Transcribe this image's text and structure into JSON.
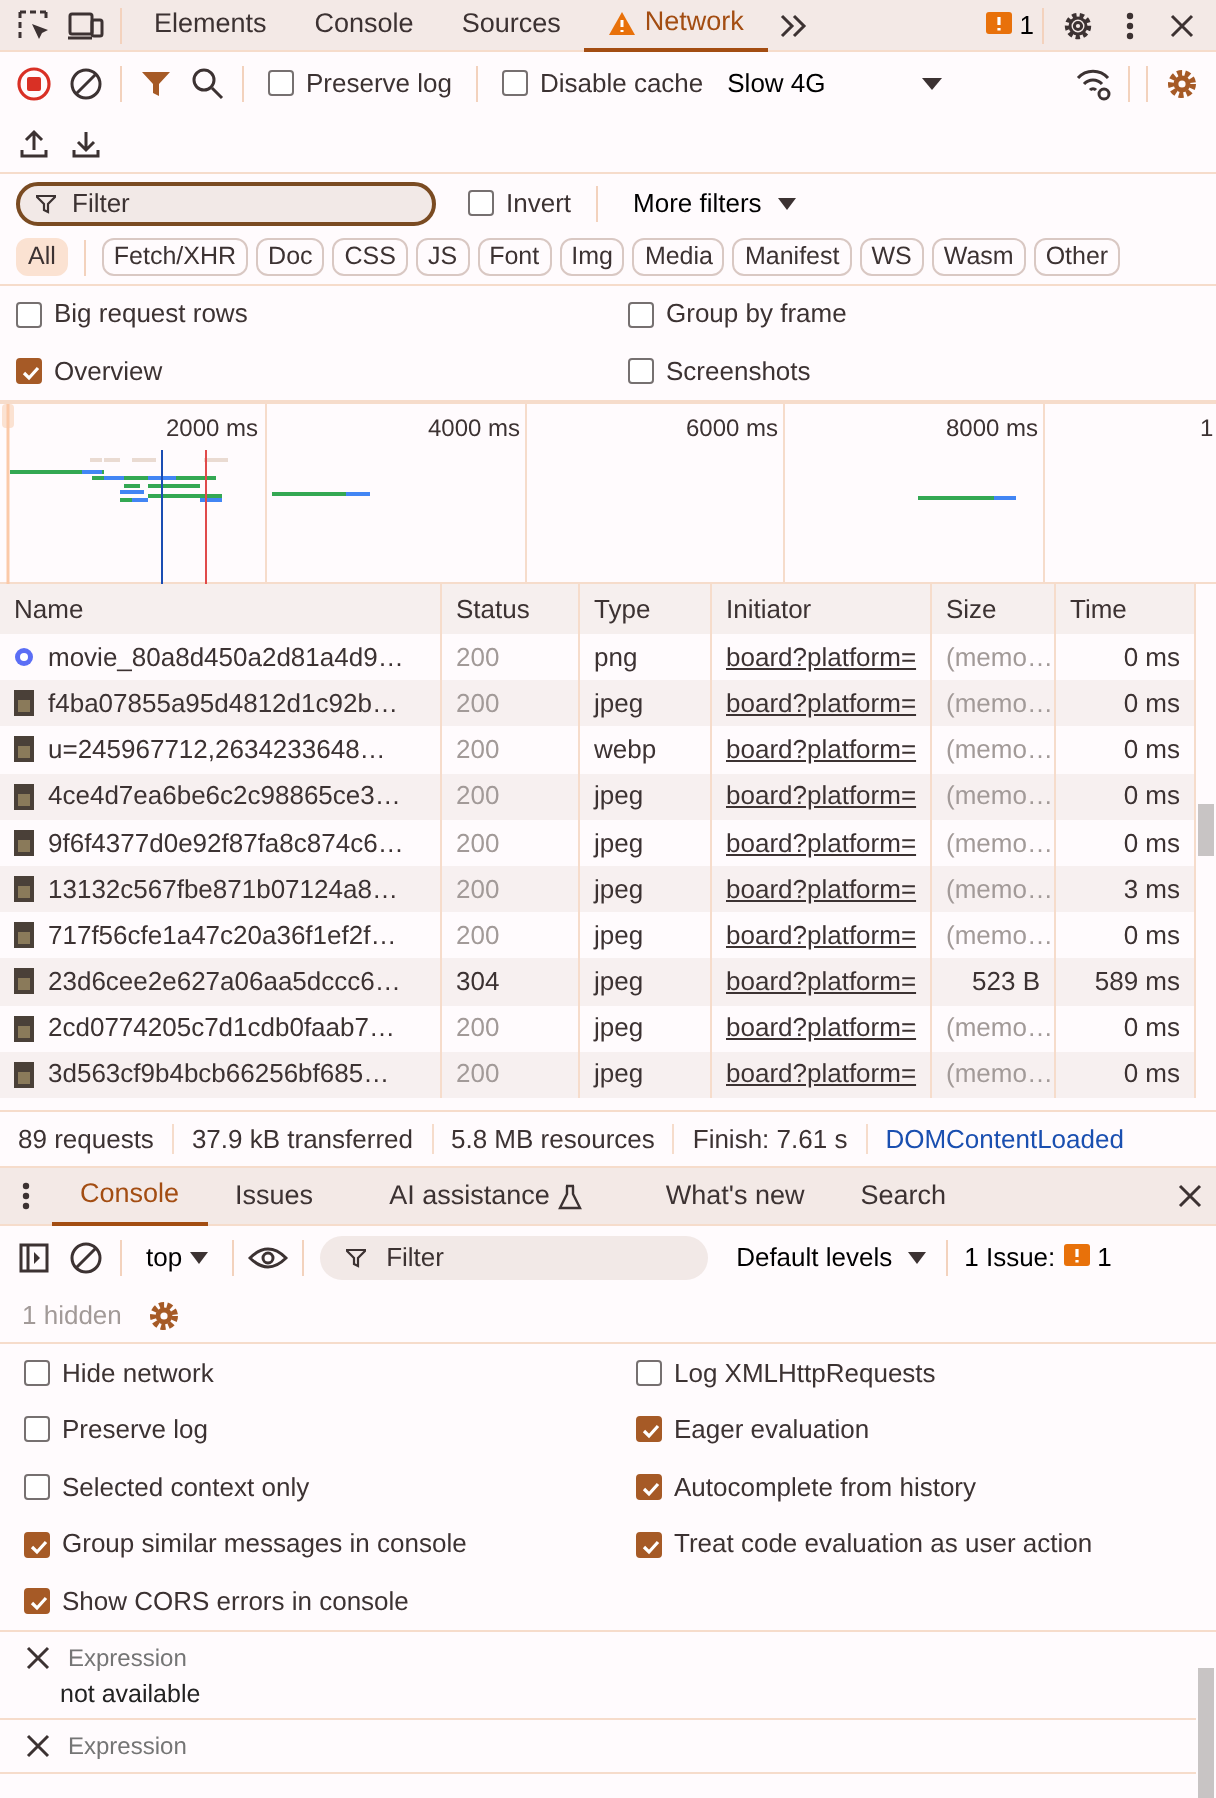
{
  "main_tabs": [
    {
      "label": "Elements",
      "selected": false,
      "warning": false
    },
    {
      "label": "Console",
      "selected": false,
      "warning": false
    },
    {
      "label": "Sources",
      "selected": false,
      "warning": false
    },
    {
      "label": "Network",
      "selected": true,
      "warning": true
    }
  ],
  "issues_badge": "1",
  "toolbar": {
    "recording": true,
    "preserve_log": {
      "label": "Preserve log",
      "checked": false
    },
    "disable_cache": {
      "label": "Disable cache",
      "checked": false
    },
    "throttling": "Slow 4G"
  },
  "filter": {
    "placeholder": "Filter",
    "invert": {
      "label": "Invert",
      "checked": false
    },
    "more_filters": "More filters"
  },
  "type_filters": [
    {
      "label": "All",
      "selected": true
    },
    {
      "label": "Fetch/XHR",
      "selected": false
    },
    {
      "label": "Doc",
      "selected": false
    },
    {
      "label": "CSS",
      "selected": false
    },
    {
      "label": "JS",
      "selected": false
    },
    {
      "label": "Font",
      "selected": false
    },
    {
      "label": "Img",
      "selected": false
    },
    {
      "label": "Media",
      "selected": false
    },
    {
      "label": "Manifest",
      "selected": false
    },
    {
      "label": "WS",
      "selected": false
    },
    {
      "label": "Wasm",
      "selected": false
    },
    {
      "label": "Other",
      "selected": false
    }
  ],
  "options": [
    {
      "label": "Big request rows",
      "checked": false
    },
    {
      "label": "Group by frame",
      "checked": false
    },
    {
      "label": "Overview",
      "checked": true
    },
    {
      "label": "Screenshots",
      "checked": false
    }
  ],
  "overview": {
    "ticks": [
      "2000 ms",
      "4000 ms",
      "6000 ms",
      "8000 ms",
      "1"
    ]
  },
  "table": {
    "columns": [
      "Name",
      "Status",
      "Type",
      "Initiator",
      "Size",
      "Time"
    ],
    "rows": [
      {
        "name": "movie_80a8d450a2d81a4d9…",
        "status": "200",
        "type": "png",
        "initiator": "board?platform=",
        "size": "(memo…",
        "time": "0 ms",
        "cached": true,
        "kind": "logo"
      },
      {
        "name": "f4ba07855a95d4812d1c92b…",
        "status": "200",
        "type": "jpeg",
        "initiator": "board?platform=",
        "size": "(memo…",
        "time": "0 ms",
        "cached": true,
        "kind": "photo"
      },
      {
        "name": "u=245967712,2634233648…",
        "status": "200",
        "type": "webp",
        "initiator": "board?platform=",
        "size": "(memo…",
        "time": "0 ms",
        "cached": true,
        "kind": "photo"
      },
      {
        "name": "4ce4d7ea6be6c2c98865ce3…",
        "status": "200",
        "type": "jpeg",
        "initiator": "board?platform=",
        "size": "(memo…",
        "time": "0 ms",
        "cached": true,
        "kind": "photo"
      },
      {
        "name": "9f6f4377d0e92f87fa8c874c6…",
        "status": "200",
        "type": "jpeg",
        "initiator": "board?platform=",
        "size": "(memo…",
        "time": "0 ms",
        "cached": true,
        "kind": "photo"
      },
      {
        "name": "13132c567fbe871b07124a8…",
        "status": "200",
        "type": "jpeg",
        "initiator": "board?platform=",
        "size": "(memo…",
        "time": "3 ms",
        "cached": true,
        "kind": "photo"
      },
      {
        "name": "717f56cfe1a47c20a36f1ef2f…",
        "status": "200",
        "type": "jpeg",
        "initiator": "board?platform=",
        "size": "(memo…",
        "time": "0 ms",
        "cached": true,
        "kind": "photo"
      },
      {
        "name": "23d6cee2e627a06aa5dccc6…",
        "status": "304",
        "type": "jpeg",
        "initiator": "board?platform=",
        "size": "523 B",
        "time": "589 ms",
        "cached": false,
        "kind": "photo"
      },
      {
        "name": "2cd0774205c7d1cdb0faab7…",
        "status": "200",
        "type": "jpeg",
        "initiator": "board?platform=",
        "size": "(memo…",
        "time": "0 ms",
        "cached": true,
        "kind": "photo"
      },
      {
        "name": "3d563cf9b4bcb66256bf685…",
        "status": "200",
        "type": "jpeg",
        "initiator": "board?platform=",
        "size": "(memo…",
        "time": "0 ms",
        "cached": true,
        "kind": "photo"
      }
    ]
  },
  "summary": [
    "89 requests",
    "37.9 kB transferred",
    "5.8 MB resources",
    "Finish: 7.61 s"
  ],
  "dom_content_loaded": "DOMContentLoaded",
  "drawer_tabs": [
    {
      "label": "Console",
      "selected": true,
      "flask": false
    },
    {
      "label": "Issues",
      "selected": false,
      "flask": false
    },
    {
      "label": "AI assistance",
      "selected": false,
      "flask": true
    },
    {
      "label": "What's new",
      "selected": false,
      "flask": false
    },
    {
      "label": "Search",
      "selected": false,
      "flask": false
    }
  ],
  "console_toolbar": {
    "context": "top",
    "filter_placeholder": "Filter",
    "levels": "Default levels",
    "issues_label": "1 Issue:",
    "issues_count": "1"
  },
  "hidden": "1 hidden",
  "console_settings": {
    "left": [
      {
        "label": "Hide network",
        "checked": false
      },
      {
        "label": "Preserve log",
        "checked": false
      },
      {
        "label": "Selected context only",
        "checked": false
      },
      {
        "label": "Group similar messages in console",
        "checked": true
      },
      {
        "label": "Show CORS errors in console",
        "checked": true
      }
    ],
    "right": [
      {
        "label": "Log XMLHttpRequests",
        "checked": false
      },
      {
        "label": "Eager evaluation",
        "checked": true
      },
      {
        "label": "Autocomplete from history",
        "checked": true
      },
      {
        "label": "Treat code evaluation as user action",
        "checked": true
      }
    ]
  },
  "live_expressions": [
    {
      "placeholder": "Expression",
      "value": "not available"
    },
    {
      "placeholder": "Expression"
    }
  ]
}
